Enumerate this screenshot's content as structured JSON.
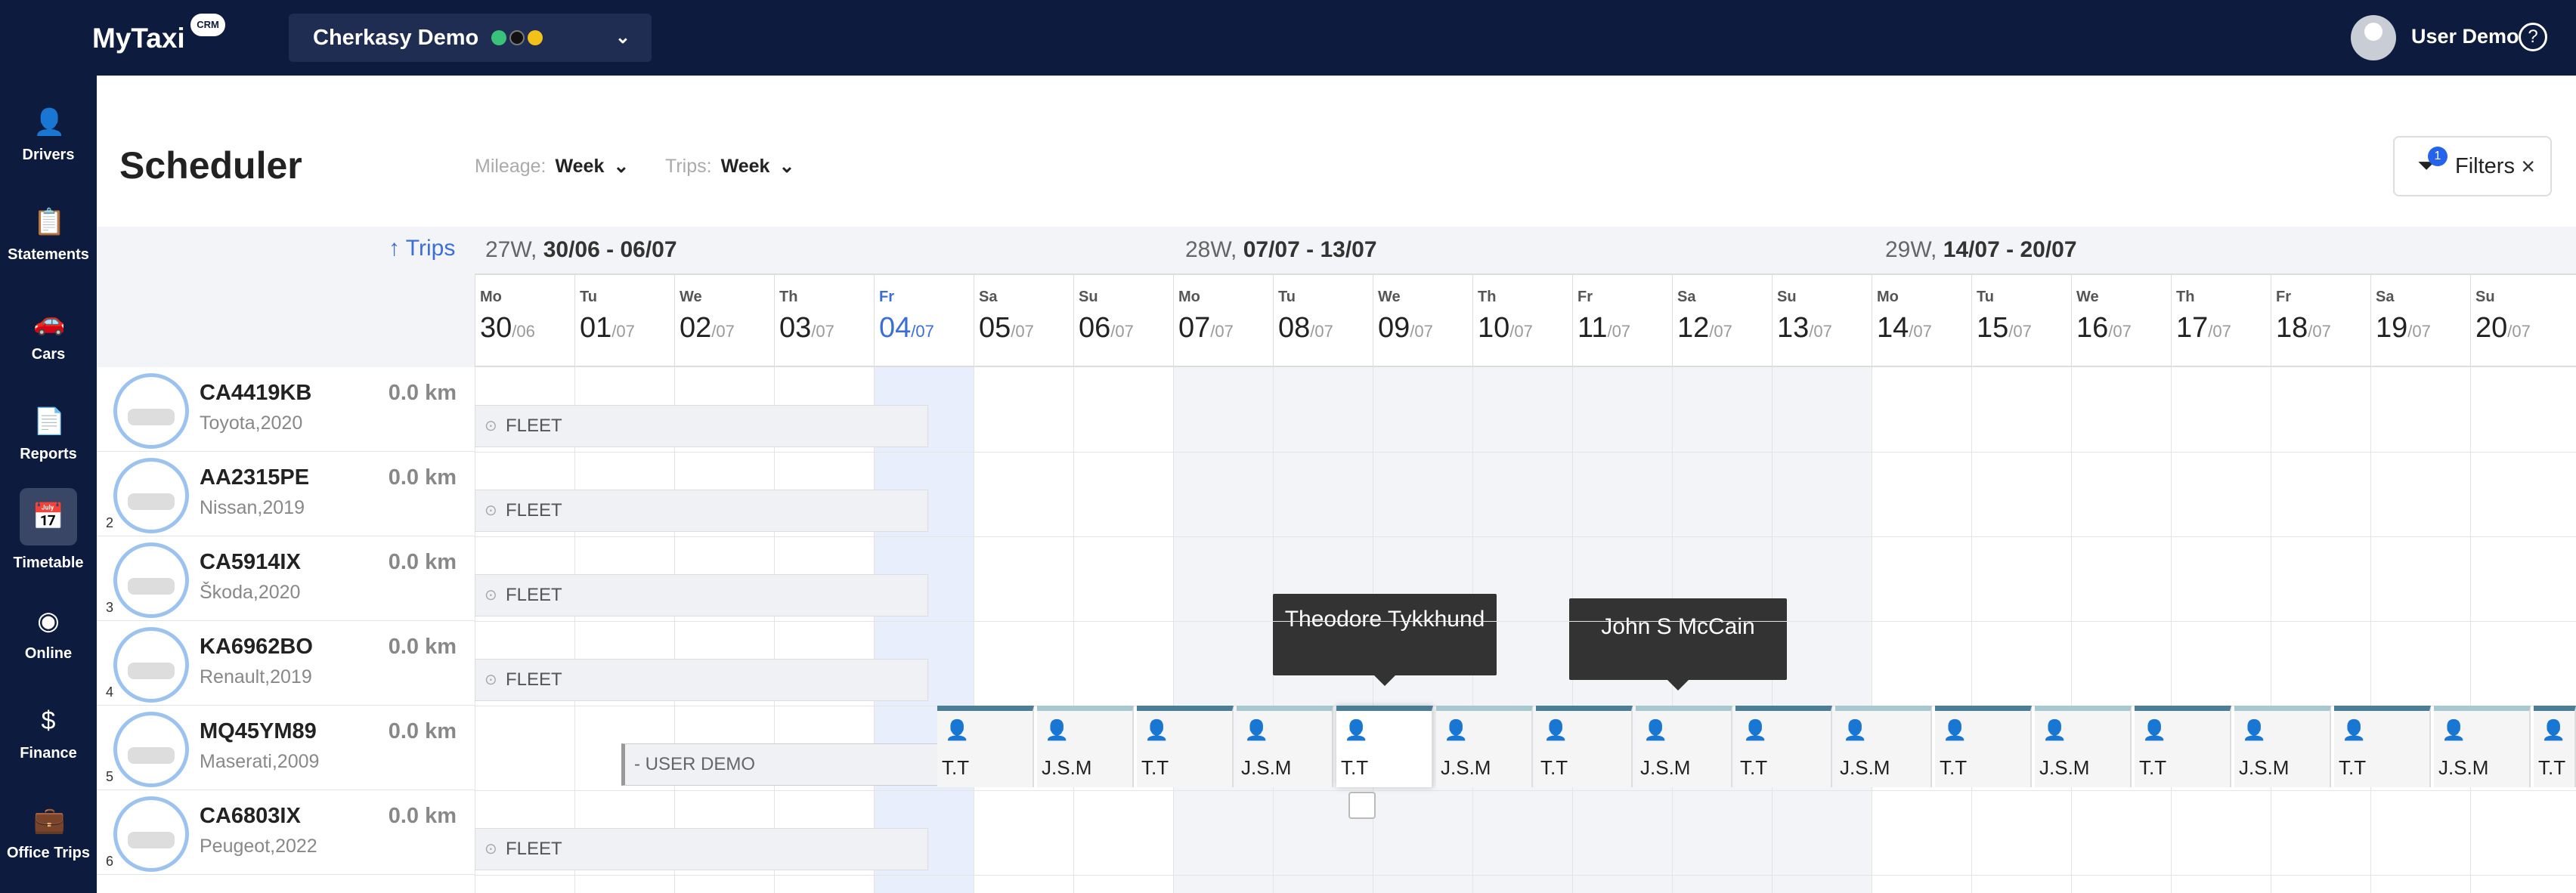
{
  "app": {
    "logo": "MyTaxi",
    "badge": "CRM"
  },
  "header": {
    "location": "Cherkasy Demo",
    "user": "User Demo"
  },
  "sidebar": {
    "items": [
      {
        "label": "Drivers"
      },
      {
        "label": "Statements"
      },
      {
        "label": "Cars"
      },
      {
        "label": "Reports"
      },
      {
        "label": "Timetable"
      },
      {
        "label": "Online"
      },
      {
        "label": "Finance"
      },
      {
        "label": "Office Trips"
      }
    ]
  },
  "page": {
    "title": "Scheduler",
    "mileage_label": "Mileage:",
    "mileage_value": "Week",
    "trips_label": "Trips:",
    "trips_value": "Week",
    "filters_label": "Filters",
    "filters_count": "1",
    "trips_sort": "↑ Trips"
  },
  "weeks": [
    {
      "w": "27W,",
      "range": "30/06 - 06/07"
    },
    {
      "w": "28W,",
      "range": "07/07 - 13/07"
    },
    {
      "w": "29W,",
      "range": "14/07 - 20/07"
    }
  ],
  "days": [
    {
      "dw": "Mo",
      "d": "30",
      "m": "/06"
    },
    {
      "dw": "Tu",
      "d": "01",
      "m": "/07"
    },
    {
      "dw": "We",
      "d": "02",
      "m": "/07"
    },
    {
      "dw": "Th",
      "d": "03",
      "m": "/07"
    },
    {
      "dw": "Fr",
      "d": "04",
      "m": "/07"
    },
    {
      "dw": "Sa",
      "d": "05",
      "m": "/07"
    },
    {
      "dw": "Su",
      "d": "06",
      "m": "/07"
    },
    {
      "dw": "Mo",
      "d": "07",
      "m": "/07"
    },
    {
      "dw": "Tu",
      "d": "08",
      "m": "/07"
    },
    {
      "dw": "We",
      "d": "09",
      "m": "/07"
    },
    {
      "dw": "Th",
      "d": "10",
      "m": "/07"
    },
    {
      "dw": "Fr",
      "d": "11",
      "m": "/07"
    },
    {
      "dw": "Sa",
      "d": "12",
      "m": "/07"
    },
    {
      "dw": "Su",
      "d": "13",
      "m": "/07"
    },
    {
      "dw": "Mo",
      "d": "14",
      "m": "/07"
    },
    {
      "dw": "Tu",
      "d": "15",
      "m": "/07"
    },
    {
      "dw": "We",
      "d": "16",
      "m": "/07"
    },
    {
      "dw": "Th",
      "d": "17",
      "m": "/07"
    },
    {
      "dw": "Fr",
      "d": "18",
      "m": "/07"
    },
    {
      "dw": "Sa",
      "d": "19",
      "m": "/07"
    },
    {
      "dw": "Su",
      "d": "20",
      "m": "/07"
    }
  ],
  "cars": [
    {
      "plate": "CA4419KB",
      "model": "Toyota,2020",
      "km": "0.0 km",
      "num": "",
      "assign": "FLEET"
    },
    {
      "plate": "AA2315PE",
      "model": "Nissan,2019",
      "km": "0.0 km",
      "num": "2",
      "assign": "FLEET"
    },
    {
      "plate": "CA5914IX",
      "model": "Škoda,2020",
      "km": "0.0 km",
      "num": "3",
      "assign": "FLEET"
    },
    {
      "plate": "KA6962BO",
      "model": "Renault,2019",
      "km": "0.0 km",
      "num": "4",
      "assign": "FLEET"
    },
    {
      "plate": "MQ45YM89",
      "model": "Maserati,2009",
      "km": "0.0 km",
      "num": "5",
      "assign": "- USER DEMO"
    },
    {
      "plate": "CA6803IX",
      "model": "Peugeot,2022",
      "km": "0.0 km",
      "num": "6",
      "assign": "FLEET"
    }
  ],
  "trips": [
    "T.T",
    "J.S.M",
    "T.T",
    "J.S.M",
    "T.T",
    "J.S.M",
    "T.T",
    "J.S.M",
    "T.T",
    "J.S.M",
    "T.T",
    "J.S.M",
    "T.T",
    "J.S.M",
    "T.T",
    "J.S.M",
    "T.T"
  ],
  "tooltips": {
    "a": "Theodore Tykkhund",
    "b": "John S McCain"
  }
}
